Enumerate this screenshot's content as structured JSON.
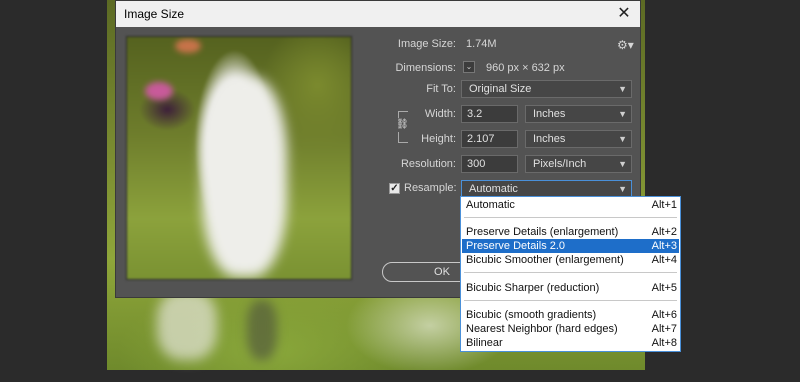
{
  "dialog": {
    "title": "Image Size",
    "close_glyph": "✕"
  },
  "info": {
    "image_size_label": "Image Size:",
    "image_size_value": "1.74M",
    "dimensions_label": "Dimensions:",
    "dimensions_value": "960 px  ×  632 px",
    "fit_to_label": "Fit To:",
    "fit_to_value": "Original Size"
  },
  "fields": {
    "width_label": "Width:",
    "width_value": "3.2",
    "width_unit": "Inches",
    "height_label": "Height:",
    "height_value": "2.107",
    "height_unit": "Inches",
    "resolution_label": "Resolution:",
    "resolution_value": "300",
    "resolution_unit": "Pixels/Inch"
  },
  "resample": {
    "label": "Resample:",
    "checked": true,
    "value": "Automatic",
    "options": [
      {
        "label": "Automatic",
        "shortcut": "Alt+1"
      },
      {
        "label": "Preserve Details (enlargement)",
        "shortcut": "Alt+2"
      },
      {
        "label": "Preserve Details 2.0",
        "shortcut": "Alt+3",
        "selected": true
      },
      {
        "label": "Bicubic Smoother (enlargement)",
        "shortcut": "Alt+4"
      },
      {
        "label": "Bicubic Sharper (reduction)",
        "shortcut": "Alt+5"
      },
      {
        "label": "Bicubic (smooth gradients)",
        "shortcut": "Alt+6"
      },
      {
        "label": "Nearest Neighbor (hard edges)",
        "shortcut": "Alt+7"
      },
      {
        "label": "Bilinear",
        "shortcut": "Alt+8"
      }
    ]
  },
  "buttons": {
    "ok_label": "OK"
  },
  "icons": {
    "gear": "gear-icon",
    "link": "link-icon",
    "caret": "chevron-down-icon"
  },
  "colors": {
    "dialog_bg": "#535353",
    "selection": "#1e6ec9",
    "focus_border": "#4a90d9"
  }
}
